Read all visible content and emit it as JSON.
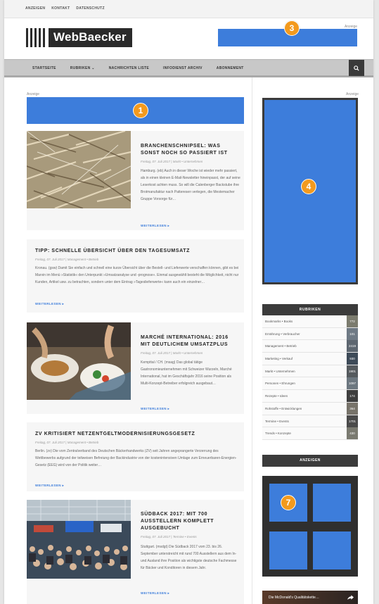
{
  "topbar": {
    "links": [
      "ANZEIGEN",
      "KONTAKT",
      "DATENSCHUTZ"
    ]
  },
  "header": {
    "logo_text": "WebBaecker",
    "anzeige_label": "Anzeige"
  },
  "nav": {
    "items": [
      "STARTSEITE",
      "RUBRIKEN ⌄",
      "NACHRICHTEN LISTE",
      "INFODIENST ARCHIV",
      "ABONNEMENT"
    ],
    "search_icon": "search-icon"
  },
  "badges": [
    "1",
    "3",
    "4",
    "7"
  ],
  "main": {
    "anzeige_label": "Anzeige",
    "articles": [
      {
        "title": "BRANCHENSCHNIPSEL: WAS SONST NOCH SO PASSIERT IST",
        "meta": "Freitag, 07. Juli 2017   |   Markt • Unternehmen",
        "excerpt": "Hamburg. (eb) Auch in dieser Woche ist wieder mehr passiert, als in einen kleinen E-Mail-Newsletter hineinpasst, der auf seine Leserkost achten muss. So will die Calenberger Backstube ihre Brotmanufaktur nach Patteresen verlegen, die Mestemacher Gruppe Vorsorge für…",
        "more": "WEITERLESEN ▸"
      },
      {
        "title": "TIPP: SCHNELLE ÜBERSICHT ÜBER DEN TAGESUMSATZ",
        "meta": "Freitag, 07. Juli 2017   |   Management • Betrieb",
        "excerpt": "Kronau. (gsw) Damit Sie einfach und schnell eine kurze Übersicht über die Bestell- und Lieferwerte verschaffen können, gibt es bei Marvin im Menü »Statistik« den Unterpunkt »Umsatzanalyse und -prognose«. Einmal ausgewählt besteht die Möglichkeit, nicht nur Kunden, Artikel usw. zu betrachten, sondern unter dem Eintrag »Tageslieferwerte« kann auch ein einzelner…",
        "more": "WEITERLESEN ▸"
      },
      {
        "title": "MARCHÉ INTERNATIONAL: 2016 MIT DEUTLICHEM UMSATZPLUS",
        "meta": "Freitag, 07. Juli 2017   |   Markt • Unternehmen",
        "excerpt": "Kempttal / CH. (msag) Das global tätige Gastronomieunternehmen mit Schweizer Wurzeln, Marché International, hat im Geschäftsjahr 2016 seine Position als Multi-Konzept-Betreiber erfolgreich ausgebaut…",
        "more": "WEITERLESEN ▸"
      },
      {
        "title": "ZV KRITISIERT NETZENTGELTMODERNISIERUNGSGESETZ",
        "meta": "Freitag, 07. Juli 2017   |   Management • Betrieb",
        "excerpt": "Berlin. (zv) Die vom Zentralverband des Deutschen Bäckerhandwerks (ZV) seit Jahren angeprangerte Verzerrung des Wettbewerbs aufgrund der teilweisen Befreiung der Backindustrie von der kostenintensiven Umlage zum Erneuerbaren-Energien-Gesetz (EEG) wird von der Politik weiter…",
        "more": "WEITERLESEN ▸"
      },
      {
        "title": "SÜDBACK 2017: MIT 700 AUSSTELLERN KOMPLETT AUSGEBUCHT",
        "meta": "Freitag, 07. Juli 2017   |   Termine • Events",
        "excerpt": "Stuttgart. (msdgt) Die Südback 2017 vom 23. bis 26. September unterstreicht mit rund 700 Ausstellern aus dem In- und Ausland ihre Position als wichtigste deutsche Fachmesse für Bäcker und Konditoren in diesem Jahr.",
        "more": "WEITERLESEN ▸"
      }
    ]
  },
  "sidebar": {
    "anzeige_label": "Anzeige",
    "rubriken_title": "RUBRIKEN",
    "rubriken": [
      {
        "label": "Bookmarks • Books",
        "count": "772",
        "color": "#7b7b6e"
      },
      {
        "label": "Ernährung • Verbraucher",
        "count": "101",
        "color": "#6f7a85"
      },
      {
        "label": "Management • Betrieb",
        "count": "2419",
        "color": "#5d6670"
      },
      {
        "label": "Marketing • Verkauf",
        "count": "930",
        "color": "#3d4a58"
      },
      {
        "label": "Markt • Unternehmen",
        "count": "1901",
        "color": "#555a5e"
      },
      {
        "label": "Personen • Ehrungen",
        "count": "1097",
        "color": "#6c7780"
      },
      {
        "label": "Rezepte • Ideen",
        "count": "174",
        "color": "#3f3f3f"
      },
      {
        "label": "Rohstoffe • Entwicklungen",
        "count": "364",
        "color": "#77736a"
      },
      {
        "label": "Termine • Events",
        "count": "1701",
        "color": "#4a4a4a"
      },
      {
        "label": "Trends • Konzepte",
        "count": "430",
        "color": "#7a7a70"
      }
    ],
    "anzeigen_title": "ANZEIGEN",
    "video_title": "Die McDonald's Qualitätskette…"
  },
  "colors": {
    "accent": "#3d7ddb",
    "badge": "#f39a1e",
    "dark": "#3b3b3b"
  }
}
